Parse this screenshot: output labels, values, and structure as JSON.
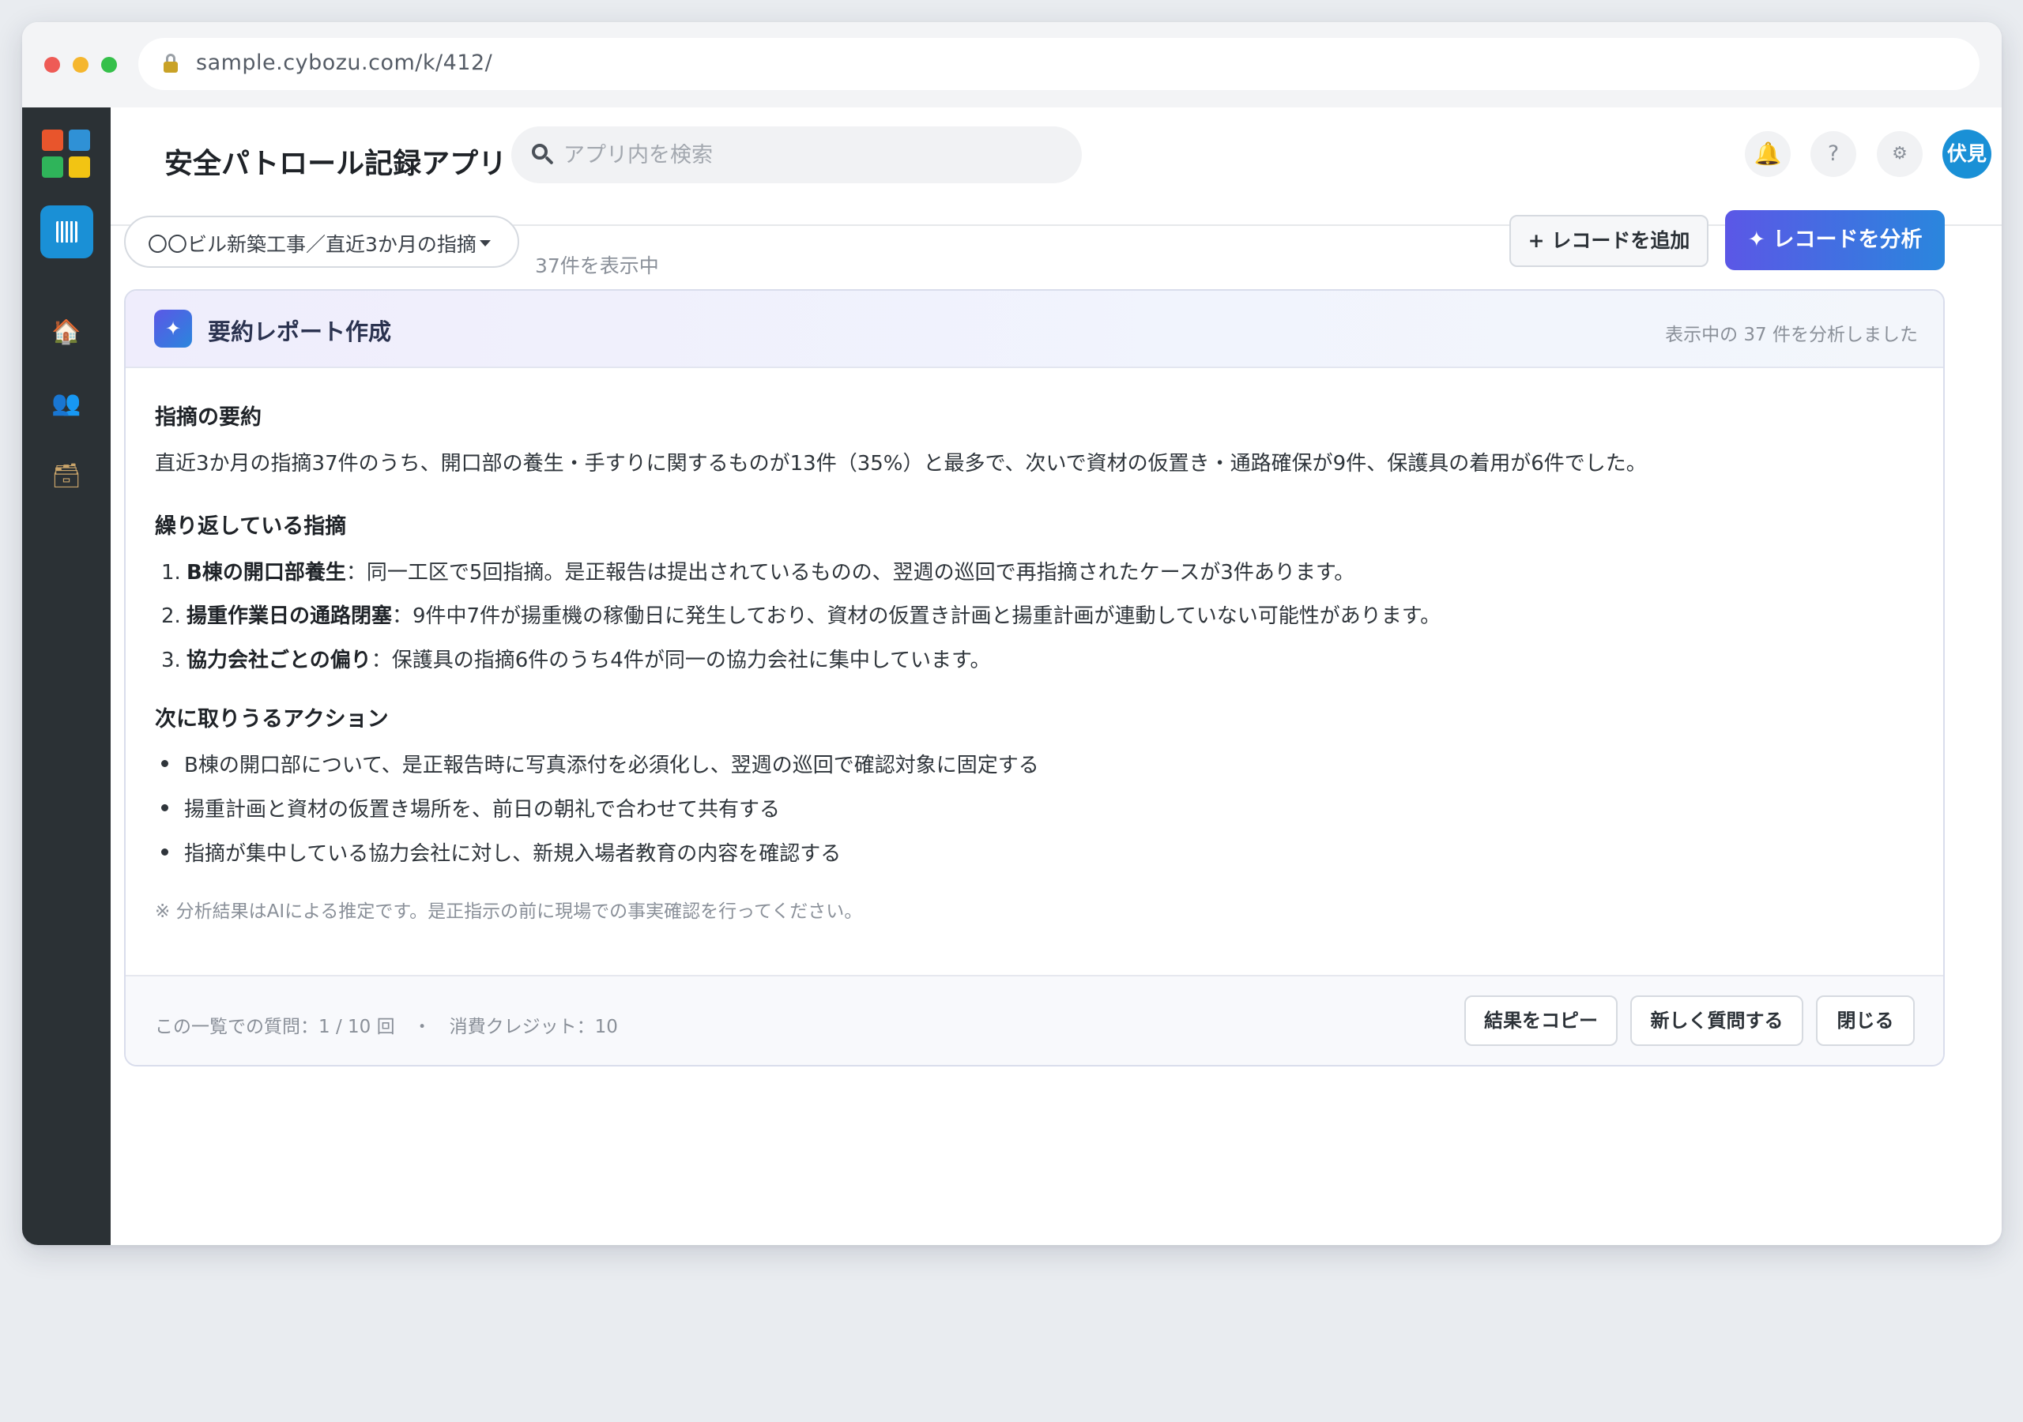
{
  "browser": {
    "url": "sample.cybozu.com/k/412/"
  },
  "sidebar": {
    "items": [
      {
        "name": "app-list",
        "icon": "grid-icon"
      },
      {
        "name": "home",
        "icon": "house-icon",
        "glyph": "🏠"
      },
      {
        "name": "people",
        "icon": "people-icon",
        "glyph": "👥"
      },
      {
        "name": "space",
        "icon": "box-icon",
        "glyph": "🗃"
      }
    ]
  },
  "header": {
    "app_title": "安全パトロール記録アプリ",
    "search_placeholder": "アプリ内を検索",
    "help_glyph": "?",
    "gear_glyph": "⚙",
    "bell_glyph": "🔔",
    "avatar_label": "伏見"
  },
  "toolbar": {
    "view_label": "〇〇ビル新築工事／直近3か月の指摘",
    "count_label": "37件を表示中",
    "add_label": "+ レコードを追加",
    "analyze_label": "✦ レコードを分析"
  },
  "report": {
    "icon_glyph": "✦",
    "title": "要約レポート作成",
    "note": "表示中の 37 件を分析しました",
    "summary_heading": "指摘の要約",
    "summary_text": "直近3か月の指摘37件のうち、開口部の養生・手すりに関するものが13件（35%）と最多で、次いで資材の仮置き・通路確保が9件、保護具の着用が6件でした。",
    "repeat_heading": "繰り返している指摘",
    "repeats": [
      {
        "num": "1.",
        "title": "B棟の開口部養生",
        "text": "：同一工区で5回指摘。是正報告は提出されているものの、翌週の巡回で再指摘されたケースが3件あります。"
      },
      {
        "num": "2.",
        "title": "揚重作業日の通路閉塞",
        "text": "：9件中7件が揚重機の稼働日に発生しており、資材の仮置き計画と揚重計画が連動していない可能性があります。"
      },
      {
        "num": "3.",
        "title": "協力会社ごとの偏り",
        "text": "：保護具の指摘6件のうち4件が同一の協力会社に集中しています。"
      }
    ],
    "action_heading": "次に取りうるアクション",
    "actions": [
      "B棟の開口部について、是正報告時に写真添付を必須化し、翌週の巡回で確認対象に固定する",
      "揚重計画と資材の仮置き場所を、前日の朝礼で合わせて共有する",
      "指摘が集中している協力会社に対し、新規入場者教育の内容を確認する"
    ],
    "disclaimer": "※ 分析結果はAIによる推定です。是正指示の前に現場での事実確認を行ってください。",
    "footer_meta": "この一覧での質問：1 / 10 回　・　消費クレジット：10",
    "copy_label": "結果をコピー",
    "ask_label": "新しく質問する",
    "close_label": "閉じる"
  },
  "colors": {
    "accent": "#1a90d6",
    "gradient_start": "#5b57e6",
    "gradient_end": "#2a86dd",
    "sidebar_bg": "#2b3135"
  }
}
